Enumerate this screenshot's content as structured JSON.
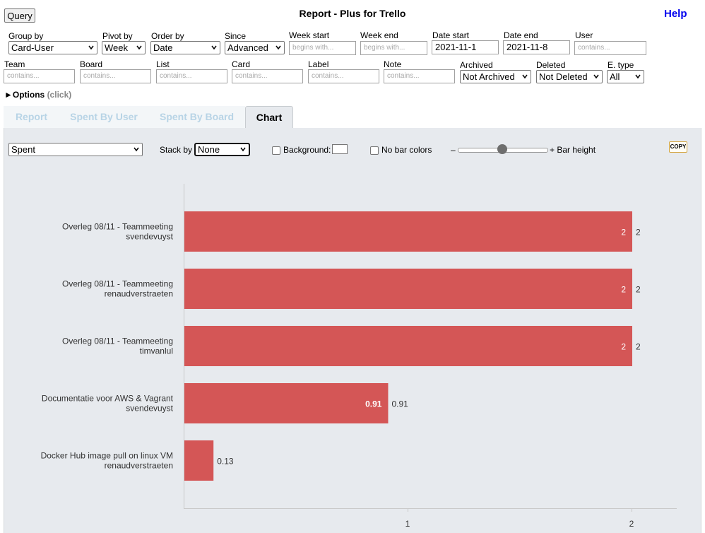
{
  "header": {
    "query_label": "Query",
    "title": "Report - Plus for Trello",
    "help_label": "Help"
  },
  "filters_row1": {
    "group_by": {
      "label": "Group by",
      "value": "Card-User"
    },
    "pivot_by": {
      "label": "Pivot by",
      "value": "Week"
    },
    "order_by": {
      "label": "Order by",
      "value": "Date"
    },
    "since": {
      "label": "Since",
      "value": "Advanced"
    },
    "week_start": {
      "label": "Week start",
      "placeholder": "begins with..."
    },
    "week_end": {
      "label": "Week end",
      "placeholder": "begins with..."
    },
    "date_start": {
      "label": "Date start",
      "value": "2021-11-1"
    },
    "date_end": {
      "label": "Date end",
      "value": "2021-11-8"
    },
    "user": {
      "label": "User",
      "placeholder": "contains..."
    }
  },
  "filters_row2": {
    "team": {
      "label": "Team",
      "placeholder": "contains..."
    },
    "board": {
      "label": "Board",
      "placeholder": "contains..."
    },
    "list": {
      "label": "List",
      "placeholder": "contains..."
    },
    "card": {
      "label": "Card",
      "placeholder": "contains..."
    },
    "label": {
      "label": "Label",
      "placeholder": "contains..."
    },
    "note": {
      "label": "Note",
      "placeholder": "contains..."
    },
    "archived": {
      "label": "Archived",
      "value": "Not Archived"
    },
    "deleted": {
      "label": "Deleted",
      "value": "Not Deleted"
    },
    "etype": {
      "label": "E. type",
      "value": "All"
    }
  },
  "options": {
    "arrow": "►",
    "label": "Options",
    "hint": "(click)"
  },
  "tabs": [
    {
      "label": "Report",
      "active": false
    },
    {
      "label": "Spent By User",
      "active": false
    },
    {
      "label": "Spent By Board",
      "active": false
    },
    {
      "label": "Chart",
      "active": true
    }
  ],
  "chart_controls": {
    "measure": "Spent",
    "stack_by_label": "Stack by",
    "stack_by_value": "None",
    "background_label": "Background:",
    "no_bar_colors_label": "No bar colors",
    "slider_minus": "–",
    "bar_height_label": "+ Bar height",
    "bar_height_level": 0.5,
    "copy_label": "COPY"
  },
  "chart_data": {
    "type": "bar",
    "orientation": "horizontal",
    "categories": [
      [
        "Overleg 08/11 - Teammeeting",
        "svendevuyst"
      ],
      [
        "Overleg 08/11 - Teammeeting",
        "renaudverstraeten"
      ],
      [
        "Overleg 08/11 - Teammeeting",
        "timvanlul"
      ],
      [
        "Documentatie voor AWS & Vagrant",
        "svendevuyst"
      ],
      [
        "Docker Hub image pull on linux VM",
        "renaudverstraeten"
      ]
    ],
    "values": [
      2,
      2,
      2,
      0.91,
      0.13
    ],
    "value_labels": [
      "2",
      "2",
      "2",
      "0.91",
      "0.13"
    ],
    "inner_labels": [
      "2",
      "2",
      "2",
      "0.91",
      ""
    ],
    "xlim": [
      0,
      2.2
    ],
    "xticks": [
      1,
      2
    ],
    "bar_color": "#d45656",
    "background": "#e7eaee",
    "grid": false
  }
}
